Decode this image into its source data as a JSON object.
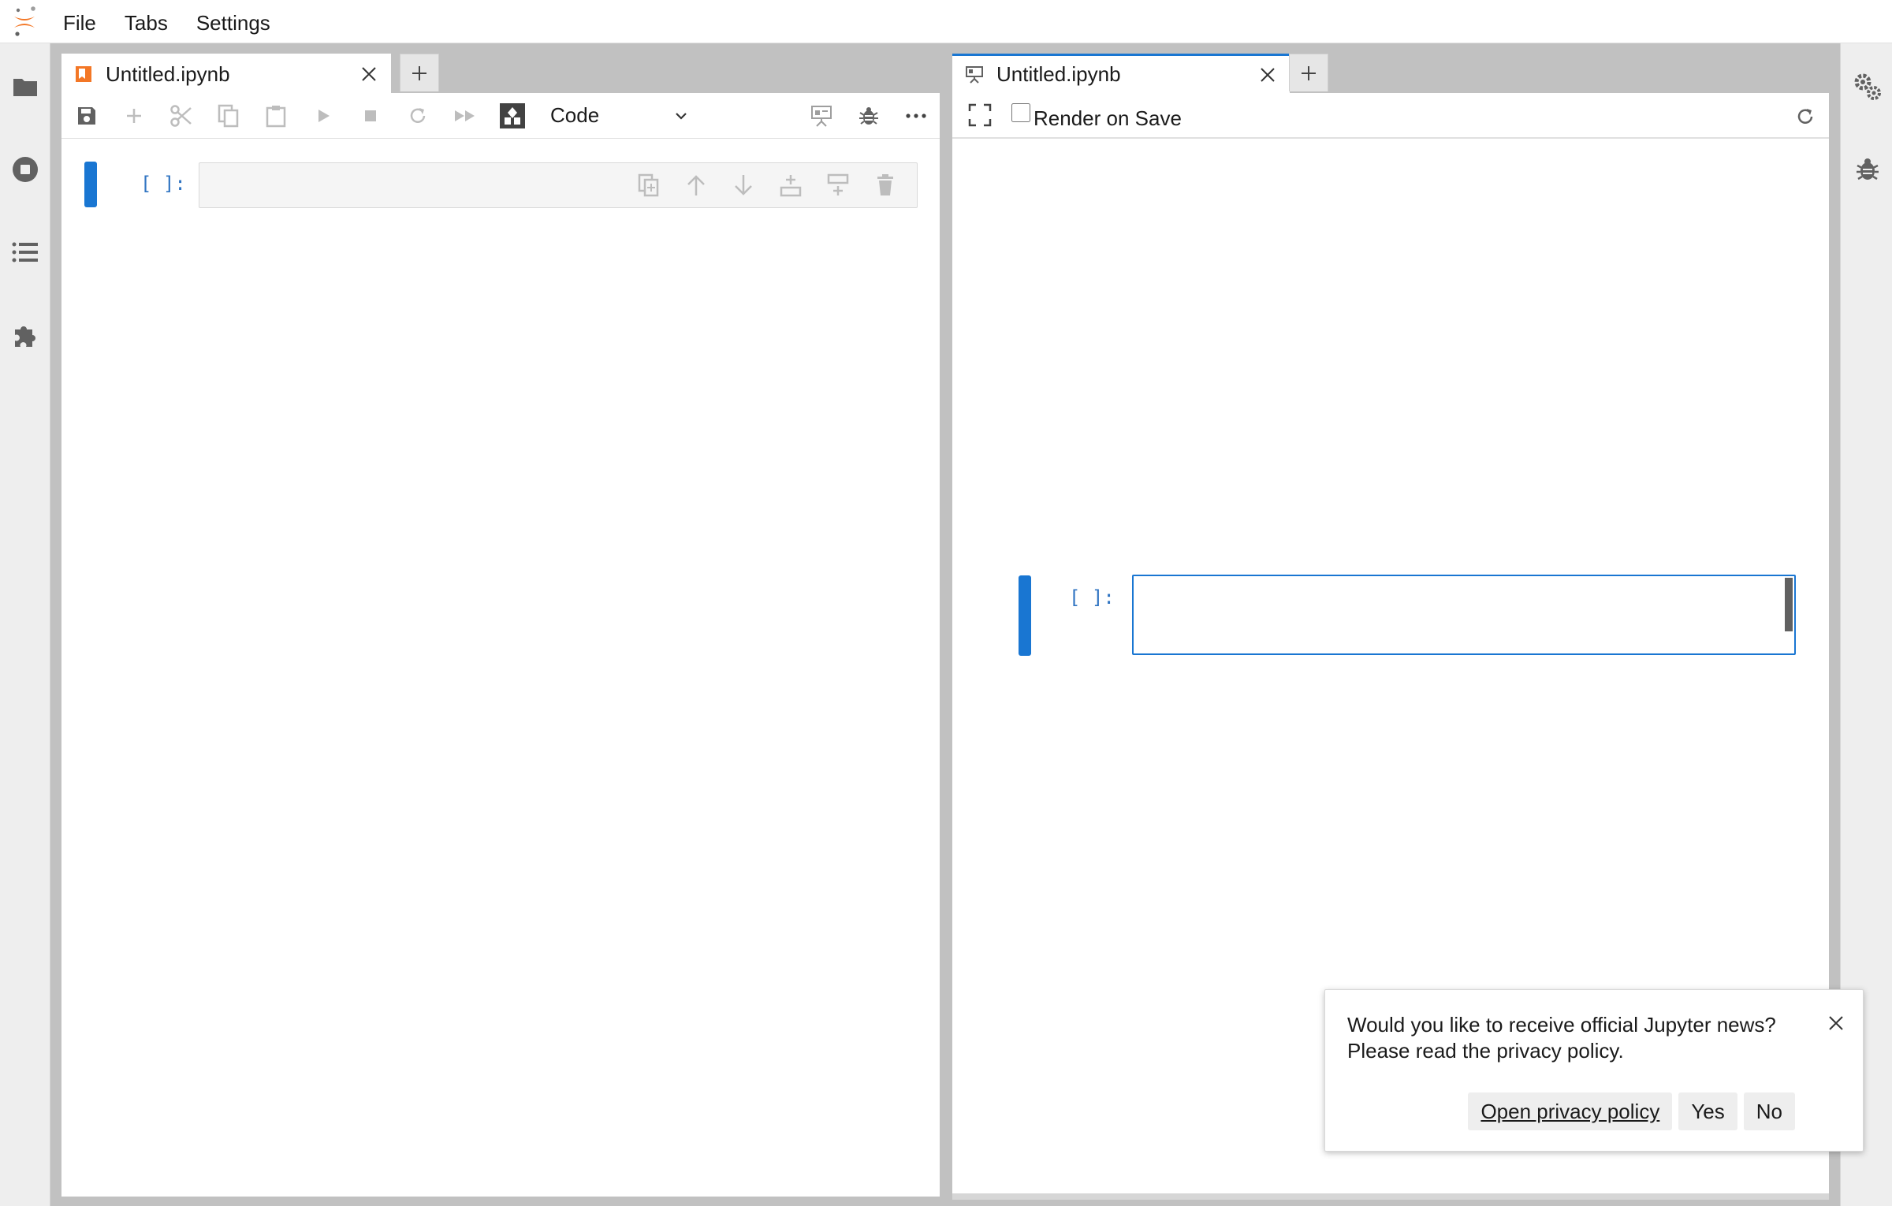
{
  "menubar": {
    "items": [
      "File",
      "Tabs",
      "Settings"
    ]
  },
  "left_sidebar": {
    "icons": [
      "folder-icon",
      "running-sessions-icon",
      "table-of-contents-icon",
      "extensions-icon"
    ]
  },
  "right_sidebar": {
    "icons": [
      "property-inspector-icon",
      "debugger-icon"
    ]
  },
  "left_panel": {
    "tab_title": "Untitled.ipynb",
    "cell_type": "Code",
    "cell_prompt": "[ ]:",
    "toolbar_icons": [
      "save-icon",
      "add-cell-icon",
      "cut-icon",
      "copy-icon",
      "paste-icon",
      "run-icon",
      "stop-icon",
      "restart-icon",
      "run-all-icon",
      "kernel-icon"
    ],
    "right_toolbar_icons": [
      "present-icon",
      "debug-icon",
      "more-icon"
    ]
  },
  "right_panel": {
    "tab_title": "Untitled.ipynb",
    "render_on_save_label": "Render on Save",
    "render_on_save_checked": false,
    "cell_prompt": "[ ]:"
  },
  "toast": {
    "line1": "Would you like to receive official Jupyter news?",
    "line2": "Please read the privacy policy.",
    "open_policy_label": "Open privacy policy",
    "yes_label": "Yes",
    "no_label": "No"
  },
  "colors": {
    "accent": "#1976d2",
    "prompt": "#3074c2",
    "jupyter_orange": "#f37726"
  }
}
